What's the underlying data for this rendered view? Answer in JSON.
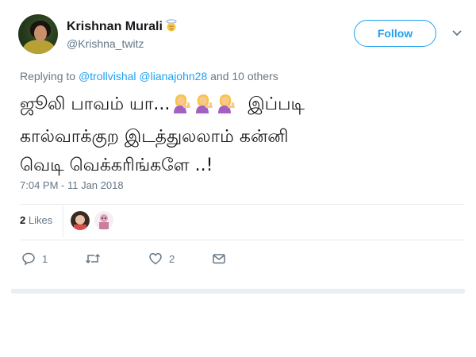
{
  "user": {
    "name": "Krishnan Murali",
    "handle": "@Krishna_twitz",
    "badge_icon": "angel-face-icon"
  },
  "follow_label": "Follow",
  "reply_to": {
    "prefix": "Replying to ",
    "mention1": "@trollvishal",
    "mention2": "@lianajohn28",
    "suffix": " and 10 others"
  },
  "tweet": {
    "line1_a": "ஜூலி பாவம் யா...",
    "line1_emojis": [
      "woman-tipping-hand-icon",
      "woman-tipping-hand-icon",
      "woman-tipping-hand-icon"
    ],
    "line1_b": "இப்படி",
    "line2": "கால்வாக்குற இடத்துலலாம் கன்னி",
    "line3": "வெடி வெக்கரிங்களே ..!"
  },
  "timestamp": "7:04 PM - 11 Jan 2018",
  "likes": {
    "count": "2",
    "label": "Likes"
  },
  "actions": {
    "reply_count": "1",
    "retweet_count": "",
    "like_count": "2"
  },
  "colors": {
    "accent": "#1da1f2",
    "muted": "#657786",
    "text": "#14171a"
  }
}
